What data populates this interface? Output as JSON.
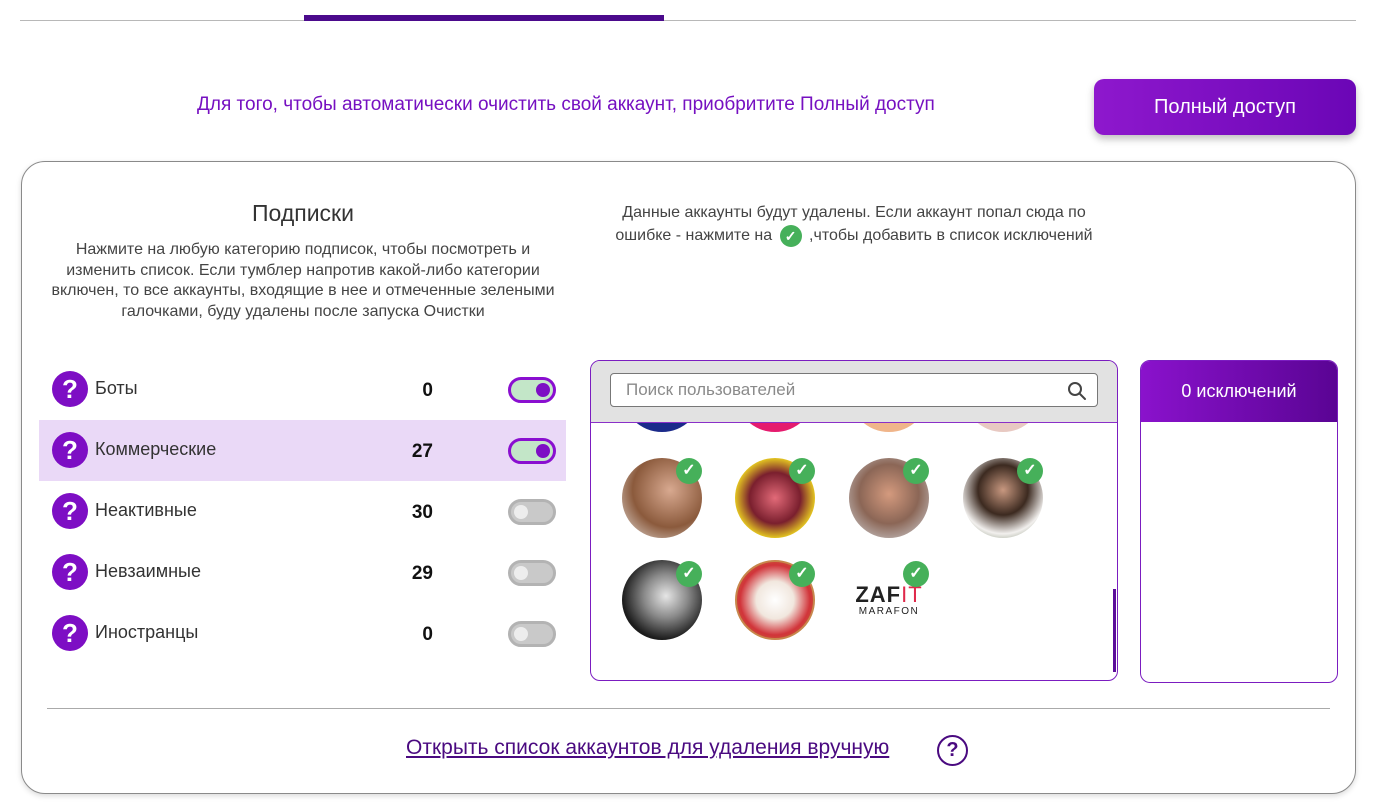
{
  "promo": {
    "text": "Для того, чтобы автоматически очистить свой аккаунт, приобритите Полный доступ",
    "button_label": "Полный доступ"
  },
  "subscriptions": {
    "title": "Подписки",
    "description": "Нажмите на любую категорию подписок, чтобы посмотреть и изменить список. Если тумблер напротив какой-либо категории включен, то все аккаунты, входящие в нее и отмеченные зелеными галочками, буду удалены после запуска Очистки",
    "help_glyph": "?",
    "categories": [
      {
        "label": "Боты",
        "count": "0",
        "enabled": true,
        "selected": false
      },
      {
        "label": "Коммерческие",
        "count": "27",
        "enabled": true,
        "selected": true
      },
      {
        "label": "Неактивные",
        "count": "30",
        "enabled": false,
        "selected": false
      },
      {
        "label": "Невзаимные",
        "count": "29",
        "enabled": false,
        "selected": false
      },
      {
        "label": "Иностранцы",
        "count": "0",
        "enabled": false,
        "selected": false
      }
    ]
  },
  "accounts": {
    "desc_part1": "Данные аккаунты будут удалены. Если аккаунт попал сюда по ошибке - нажмите на",
    "desc_part2": ",чтобы добавить в список исключений",
    "check_glyph": "✓",
    "search_placeholder": "Поиск пользователей",
    "logo_zafit_a": "ZAF",
    "logo_zafit_b": "IT",
    "logo_marafon": "MARAFON"
  },
  "exclusions": {
    "header": "0 исключений"
  },
  "footer": {
    "manual_link": "Открыть список аккаунтов для удаления вручную",
    "help_glyph": "?"
  },
  "colors": {
    "accent": "#7d0ec4",
    "accent_dark": "#4a0a80",
    "check_green": "#46b05a",
    "selected_row": "#ead9f7"
  }
}
